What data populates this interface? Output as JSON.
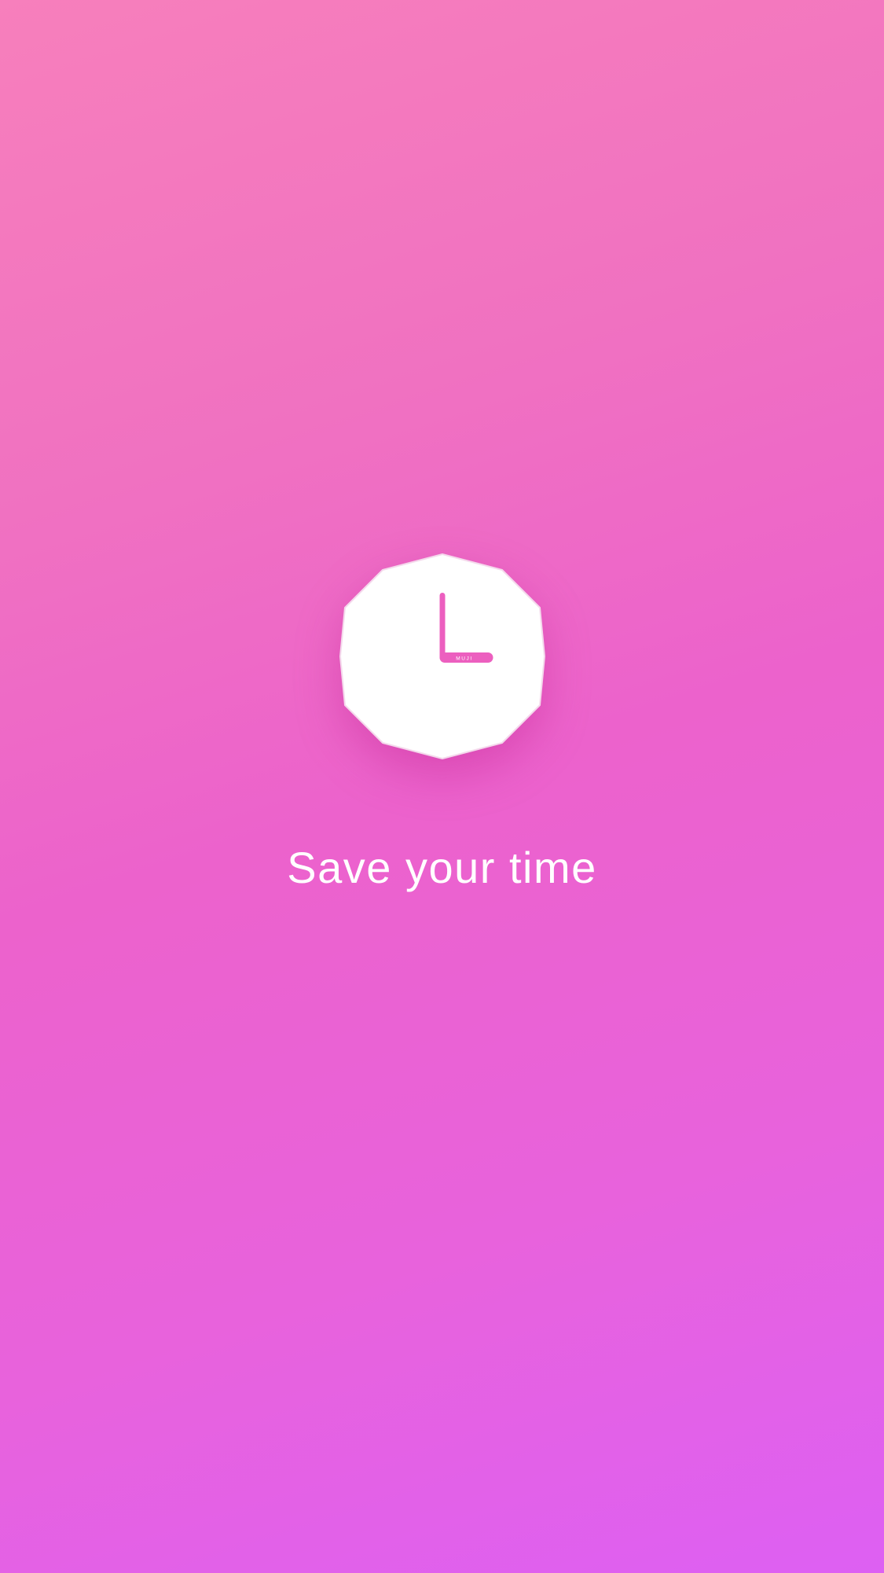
{
  "splash": {
    "logo_icon": "clock-icon",
    "logo_brand": "MUJI",
    "tagline": "Save your time"
  },
  "colors": {
    "gradient_top_right": "#f77fbc",
    "gradient_bottom_left": "#dd60f3",
    "logo_fill": "#ffffff",
    "clock_hands": "#ec5fbf",
    "tagline_text": "#ffffff"
  }
}
